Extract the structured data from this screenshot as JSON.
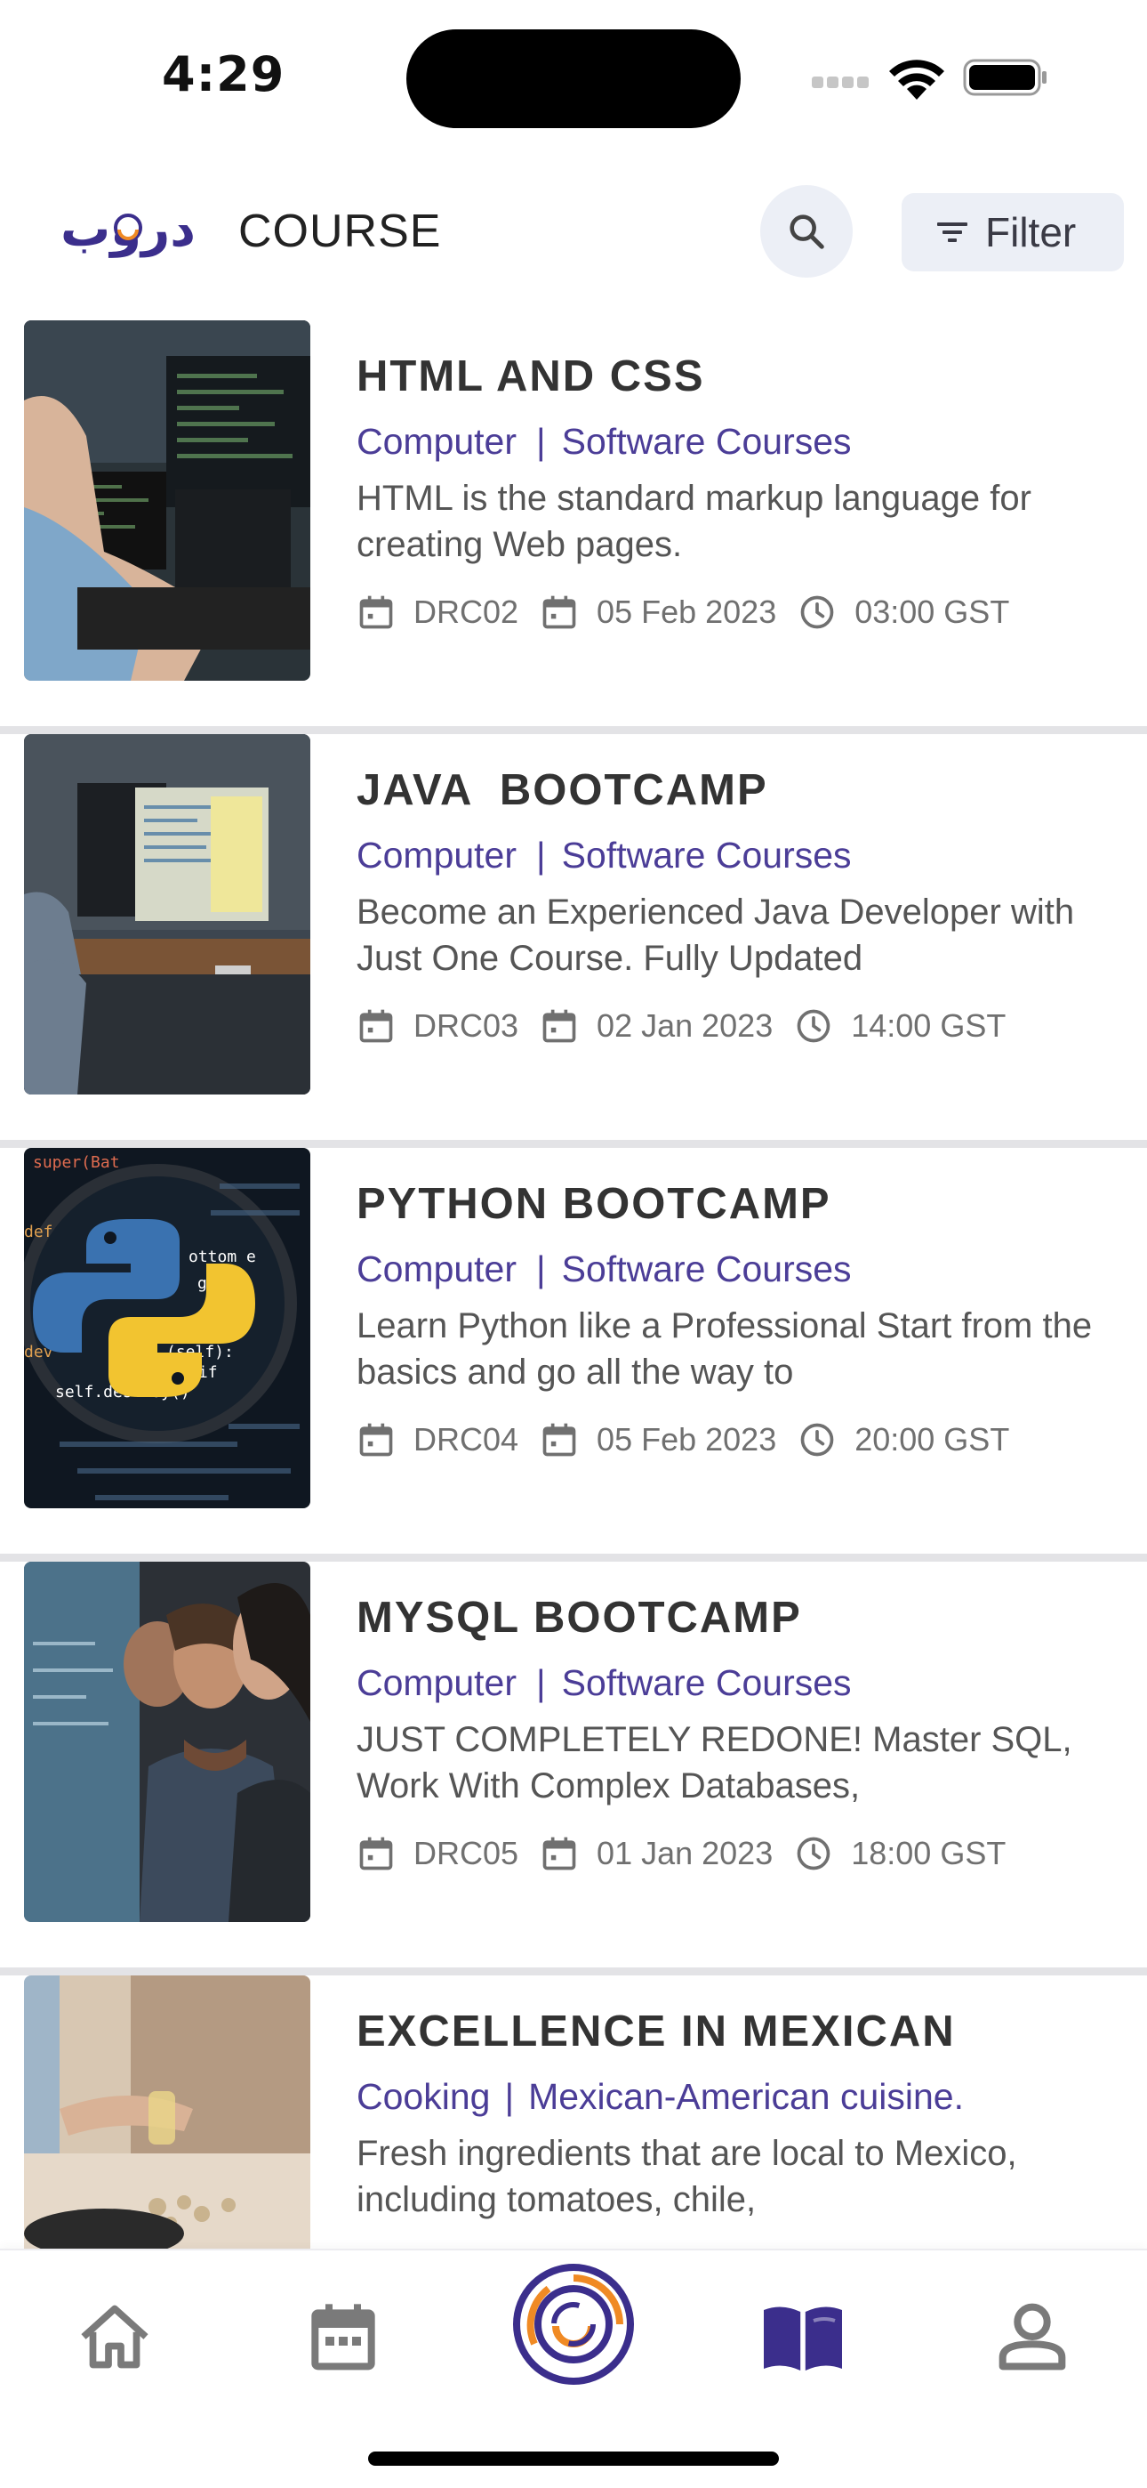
{
  "status_bar": {
    "time": "4:29"
  },
  "header": {
    "logo_text": "دروب",
    "title": "COURSE",
    "filter_label": "Filter"
  },
  "courses": [
    {
      "title": "HTML AND CSS",
      "category": "Computer",
      "subcategory": "Software Courses",
      "description": "HTML is the standard markup language for creating Web pages.",
      "code": "DRC02",
      "date": "05 Feb 2023",
      "time": "03:00 GST"
    },
    {
      "title": "JAVA  BOOTCAMP",
      "category": "Computer",
      "subcategory": "Software Courses",
      "description": "Become an Experienced Java Developer with Just One Course. Fully Updated",
      "code": "DRC03",
      "date": "02 Jan 2023",
      "time": "14:00 GST"
    },
    {
      "title": "PYTHON BOOTCAMP",
      "category": "Computer",
      "subcategory": "Software Courses",
      "description": "Learn Python like a Professional Start from the basics and go all the way to",
      "code": "DRC04",
      "date": "05 Feb 2023",
      "time": "20:00 GST"
    },
    {
      "title": "MYSQL BOOTCAMP",
      "category": "Computer",
      "subcategory": "Software Courses",
      "description": "JUST COMPLETELY REDONE! Master SQL, Work With Complex Databases,",
      "code": "DRC05",
      "date": "01 Jan 2023",
      "time": "18:00 GST"
    },
    {
      "title": "EXCELLENCE IN MEXICAN",
      "category": "Cooking",
      "subcategory": "Mexican-American cuisine.",
      "description": "Fresh ingredients that are local to Mexico, including tomatoes, chile,",
      "code": "",
      "date": "",
      "time": ""
    }
  ],
  "python_thumb_code": [
    "super(Bat",
    "def",
    "ottom e",
    "games",
    "self.destroy()",
    "dev",
    "(self):",
    "y self if"
  ],
  "bottom_nav": {
    "items": [
      "home-icon",
      "calendar-icon",
      "brand-logo-icon",
      "book-icon",
      "profile-icon"
    ],
    "active": "book-icon"
  },
  "colors": {
    "accent": "#4b3d97",
    "logo_purple": "#3b2e8c",
    "logo_orange": "#f08a24",
    "nav_icon": "#7a7a7a",
    "divider": "#e3e3e6",
    "button_bg": "#eceff6"
  }
}
